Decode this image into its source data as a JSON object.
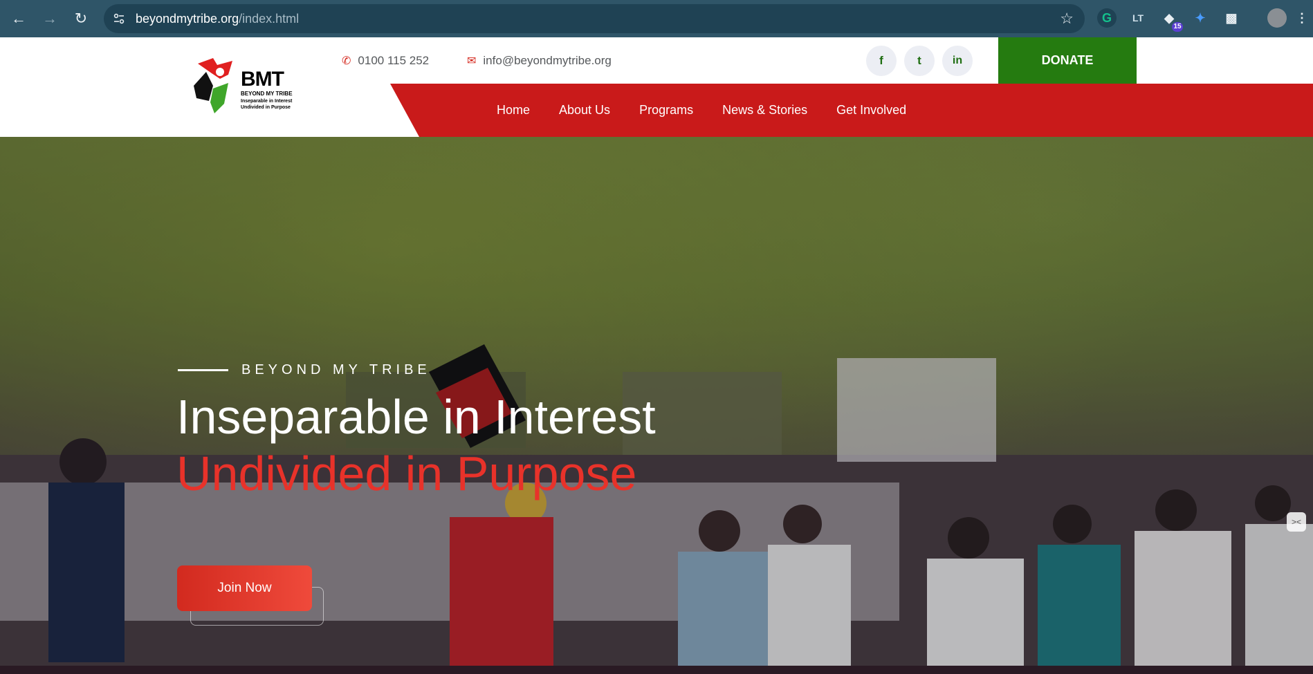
{
  "browser": {
    "url_host": "beyondmytribe.org",
    "url_path": "/index.html",
    "extension_badge": "15"
  },
  "header": {
    "logo": {
      "title": "BMT",
      "subtitle": "BEYOND MY TRIBE",
      "tagline_1": "Inseparable in Interest",
      "tagline_2": "Undivided in Purpose"
    },
    "phone": "0100 115 252",
    "email": "info@beyondmytribe.org",
    "social": [
      {
        "name": "facebook",
        "glyph": "f"
      },
      {
        "name": "twitter",
        "glyph": "t"
      },
      {
        "name": "linkedin",
        "glyph": "in"
      }
    ],
    "donate_label": "DONATE",
    "menu": [
      "Home",
      "About Us",
      "Programs",
      "News & Stories",
      "Get Involved"
    ]
  },
  "hero": {
    "eyebrow": "BEYOND MY TRIBE",
    "title_line1": "Inseparable in Interest",
    "title_line2": "Undivided in Purpose",
    "cta_label": "Join Now"
  },
  "colors": {
    "chrome": "#2f5568",
    "accent_red": "#c91a1a",
    "donate_green": "#257b10",
    "headline_red": "#e8322a"
  }
}
